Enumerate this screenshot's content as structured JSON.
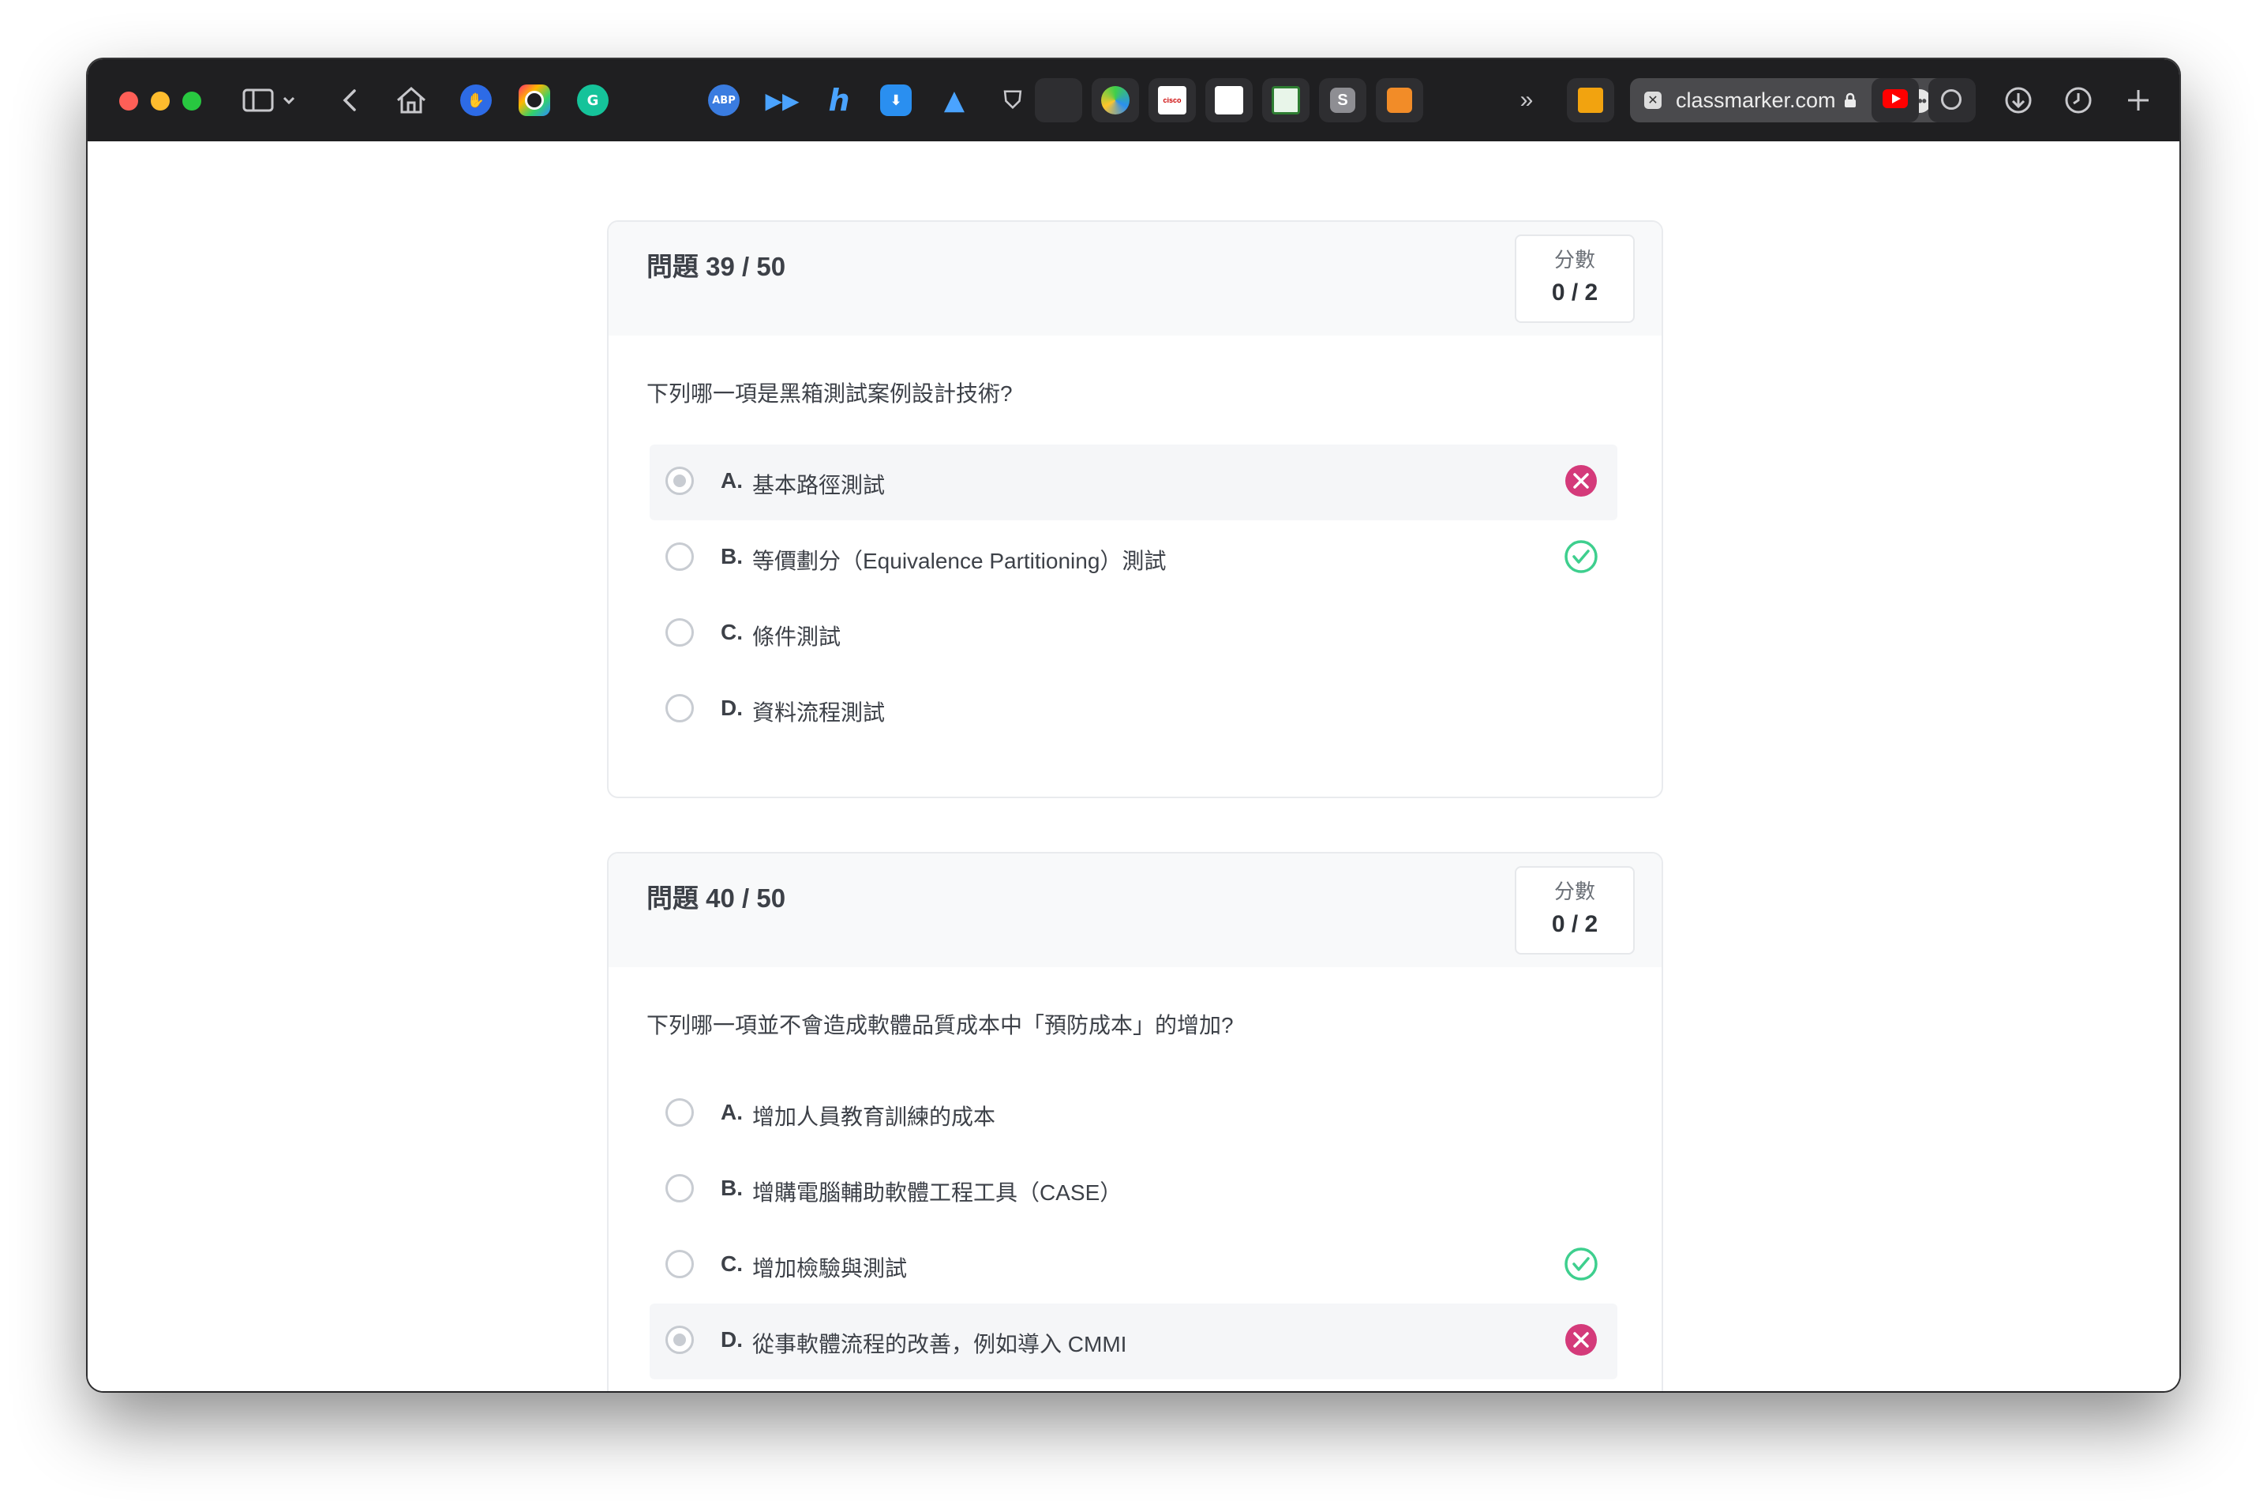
{
  "browser": {
    "url": "classmarker.com",
    "more_symbol": "•••"
  },
  "colors": {
    "correct": "#3ecf8e",
    "incorrect": "#d43a7a"
  },
  "questions": [
    {
      "title": "問題 39 / 50",
      "score_label": "分數",
      "score_value": "0 / 2",
      "text": "下列哪一項是黑箱測試案例設計技術?",
      "options": [
        {
          "letter": "A.",
          "text": "基本路徑測試",
          "selected": true,
          "mark": "incorrect"
        },
        {
          "letter": "B.",
          "text": "等價劃分（Equivalence  Partitioning）測試",
          "selected": false,
          "mark": "correct"
        },
        {
          "letter": "C.",
          "text": "條件測試",
          "selected": false,
          "mark": ""
        },
        {
          "letter": "D.",
          "text": "資料流程測試",
          "selected": false,
          "mark": ""
        }
      ]
    },
    {
      "title": "問題 40 / 50",
      "score_label": "分數",
      "score_value": "0 / 2",
      "text": "下列哪一項並不會造成軟體品質成本中「預防成本」的增加?",
      "options": [
        {
          "letter": "A.",
          "text": "增加人員教育訓練的成本",
          "selected": false,
          "mark": ""
        },
        {
          "letter": "B.",
          "text": "增購電腦輔助軟體工程工具（CASE）",
          "selected": false,
          "mark": ""
        },
        {
          "letter": "C.",
          "text": "增加檢驗與測試",
          "selected": false,
          "mark": "correct"
        },
        {
          "letter": "D.",
          "text": "從事軟體流程的改善，例如導入 CMMI",
          "selected": true,
          "mark": "incorrect"
        }
      ]
    }
  ]
}
